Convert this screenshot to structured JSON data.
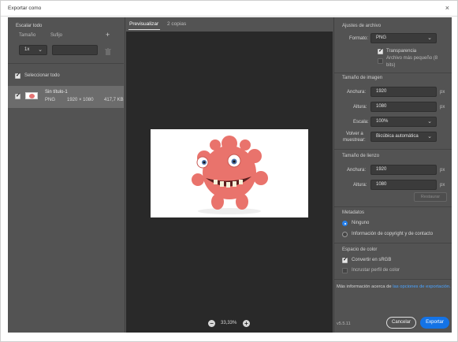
{
  "window": {
    "title": "Exportar como",
    "close_glyph": "×"
  },
  "left": {
    "scale_header": "Escalar todo",
    "col_size": "Tamaño",
    "col_suffix": "Sufijo",
    "add_glyph": "+",
    "size_value": "1x",
    "delete_icon": "trash-icon",
    "select_all_label": "Seleccionar todo",
    "file": {
      "name": "Sin título-1",
      "format": "PNG",
      "dimensions": "1920 × 1080",
      "size": "417,7 KB"
    }
  },
  "center": {
    "tabs": [
      {
        "label": "Previsualizar"
      },
      {
        "label": "2 copias"
      }
    ],
    "zoom": {
      "minus": "−",
      "value": "33,33%",
      "plus": "+"
    }
  },
  "right": {
    "file_settings": {
      "header": "Ajustes de archivo",
      "format_label": "Formato:",
      "format_value": "PNG",
      "transparency_label": "Transparencia",
      "smaller_file_label_line1": "Archivo más pequeño (8",
      "smaller_file_label_line2": "bits)"
    },
    "image_size": {
      "header": "Tamaño de imagen",
      "width_label": "Anchura:",
      "width_value": "1920",
      "height_label": "Altura:",
      "height_value": "1080",
      "scale_label": "Escala:",
      "scale_value": "100%",
      "resample_label_line1": "Volver a",
      "resample_label_line2": "muestrear:",
      "resample_value": "Bicúbica automática",
      "unit": "px"
    },
    "canvas_size": {
      "header": "Tamaño de lienzo",
      "width_label": "Anchura:",
      "width_value": "1920",
      "height_label": "Altura:",
      "height_value": "1080",
      "reset_label": "Restaurar",
      "unit": "px"
    },
    "metadata": {
      "header": "Metadatos",
      "option_none": "Ninguno",
      "option_copyright": "Información de copyright y de contacto"
    },
    "color_space": {
      "header": "Espacio de color",
      "convert_srgb": "Convertir en sRGB",
      "embed_profile": "Incrustar perfil de color"
    },
    "more_info_prefix": "Más información acerca de",
    "more_info_link": "las opciones de exportación.",
    "version": "v5.5.11",
    "cancel_label": "Cancelar",
    "export_label": "Exportar"
  },
  "colors": {
    "accent": "#1473e6",
    "panel": "#535353",
    "canvas": "#292929",
    "link": "#4aa3ff"
  }
}
